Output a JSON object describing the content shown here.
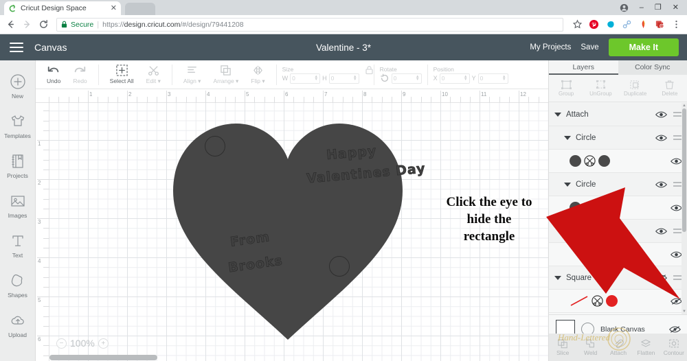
{
  "browser": {
    "tab_title": "Cricut Design Space",
    "tab_close": "✕",
    "back_icon": "back-arrow-icon",
    "forward_icon": "forward-arrow-icon",
    "reload_icon": "reload-icon",
    "secure_label": "Secure",
    "url_scheme": "https://",
    "url_host": "design.cricut.com",
    "url_path": "/#/design/79441208",
    "window_minimize": "–",
    "window_maximize": "❐",
    "window_close": "✕",
    "profile_icon": "profile-avatar-icon",
    "extensions": [
      "pinterest-icon",
      "evernote-icon",
      "link-icon",
      "feather-icon",
      "adblock-icon"
    ],
    "menu_icon": "browser-menu-icon"
  },
  "header": {
    "menu_icon": "hamburger-menu-icon",
    "canvas_label": "Canvas",
    "document_title": "Valentine - 3*",
    "my_projects": "My Projects",
    "save": "Save",
    "make_it": "Make It",
    "background": "#47555e",
    "accent_green": "#6dc72b"
  },
  "sidebar": {
    "items": [
      {
        "label": "New",
        "icon": "plus-circle-icon"
      },
      {
        "label": "Templates",
        "icon": "shirt-icon"
      },
      {
        "label": "Projects",
        "icon": "notebook-icon"
      },
      {
        "label": "Images",
        "icon": "photo-icon"
      },
      {
        "label": "Text",
        "icon": "text-T-icon"
      },
      {
        "label": "Shapes",
        "icon": "shapes-icon"
      },
      {
        "label": "Upload",
        "icon": "cloud-upload-icon"
      }
    ]
  },
  "toolbar": {
    "buttons": [
      {
        "label": "Undo",
        "icon": "undo-arrow-icon",
        "enabled": true
      },
      {
        "label": "Redo",
        "icon": "redo-arrow-icon",
        "enabled": false
      },
      {
        "label": "Select All",
        "icon": "select-all-icon",
        "enabled": true
      },
      {
        "label": "Edit",
        "icon": "edit-scissors-icon",
        "enabled": false
      },
      {
        "label": "Align",
        "icon": "align-icon",
        "enabled": false
      },
      {
        "label": "Arrange",
        "icon": "arrange-icon",
        "enabled": false
      },
      {
        "label": "Flip",
        "icon": "flip-icon",
        "enabled": false
      }
    ],
    "size": {
      "title": "Size",
      "w_key": "W",
      "w_value": "0",
      "h_key": "H",
      "h_value": "0",
      "lock_icon": "lock-icon"
    },
    "rotate": {
      "title": "Rotate",
      "icon": "rotate-icon",
      "value": "0"
    },
    "position": {
      "title": "Position",
      "x_key": "X",
      "x_value": "0",
      "y_key": "Y",
      "y_value": "0"
    }
  },
  "canvas": {
    "ruler_h_labels": [
      "1",
      "2",
      "3",
      "4",
      "5",
      "6",
      "7",
      "8",
      "9",
      "10",
      "11",
      "12"
    ],
    "ruler_v_labels": [
      "1",
      "2",
      "3",
      "4",
      "5",
      "6"
    ],
    "zoom_level": "100%",
    "zoom_out_icon": "minus-circle-icon",
    "zoom_in_icon": "plus-circle-icon",
    "shape_fill": "#464646",
    "texts": [
      {
        "id": "happy",
        "value": "Happy"
      },
      {
        "id": "valentines",
        "value": "Valentines  Day"
      },
      {
        "id": "from",
        "value": "From"
      },
      {
        "id": "brooks",
        "value": "Brooks"
      }
    ],
    "annotation": {
      "line1": "Click the eye to",
      "line2": "hide the",
      "line3": "rectangle"
    },
    "arrow_color": "#cc1111"
  },
  "right_panel": {
    "tabs": [
      {
        "label": "Layers",
        "active": true
      },
      {
        "label": "Color Sync",
        "active": false
      }
    ],
    "tools": [
      {
        "label": "Group",
        "icon": "group-icon"
      },
      {
        "label": "UnGroup",
        "icon": "ungroup-icon"
      },
      {
        "label": "Duplicate",
        "icon": "duplicate-icon"
      },
      {
        "label": "Delete",
        "icon": "trash-icon"
      }
    ],
    "layers": [
      {
        "type": "group",
        "name": "Attach",
        "indent": 0,
        "visible": true,
        "handle": true
      },
      {
        "type": "group",
        "name": "Circle",
        "indent": 1,
        "visible": true,
        "handle": true
      },
      {
        "type": "swatch",
        "name": "",
        "indent": 1,
        "visible": true,
        "handle": false,
        "colors": [
          "#4a4a4a",
          "#4a4a4a"
        ],
        "cut_icon": "scissors-circle-icon"
      },
      {
        "type": "group",
        "name": "Circle",
        "indent": 1,
        "visible": true,
        "handle": true
      },
      {
        "type": "swatch",
        "name": "",
        "indent": 1,
        "visible": true,
        "handle": false,
        "colors": [
          "#4a4a4a",
          "#4a4a4a"
        ],
        "cut_icon": "scissors-circle-icon"
      },
      {
        "type": "group",
        "name": "",
        "indent": 1,
        "visible": true,
        "handle": true
      },
      {
        "type": "swatch",
        "name": "",
        "indent": 1,
        "visible": true,
        "handle": false,
        "colors": [],
        "cut_icon": ""
      },
      {
        "type": "group",
        "name": "Square",
        "indent": 0,
        "visible": false,
        "handle": true
      },
      {
        "type": "line",
        "name": "",
        "indent": 1,
        "visible": false,
        "handle": false,
        "colors": [
          "#e32222"
        ],
        "cut_icon": "scissors-circle-icon"
      }
    ],
    "blank_canvas": {
      "label": "Blank Canvas",
      "visible": false,
      "eye_icon": "eye-off-icon"
    },
    "bottom_tools": [
      {
        "label": "Slice",
        "icon": "slice-icon"
      },
      {
        "label": "Weld",
        "icon": "weld-icon"
      },
      {
        "label": "Attach",
        "icon": "paperclip-icon"
      },
      {
        "label": "Flatten",
        "icon": "flatten-icon"
      },
      {
        "label": "Contour",
        "icon": "contour-icon"
      }
    ],
    "watermark": "Hand-Lettered"
  }
}
